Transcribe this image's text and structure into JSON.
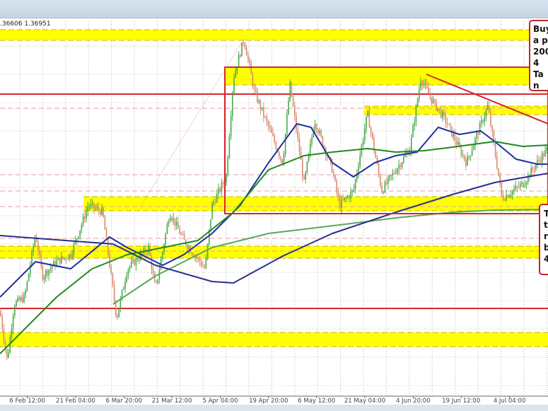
{
  "header": {
    "ohlc_text": ".36606 1.36951"
  },
  "annotations": {
    "box1_lines": [
      "Buy",
      "a p",
      "200",
      "4",
      "Ta",
      "n"
    ],
    "box2_lines": [
      "T",
      "t",
      "r",
      "b",
      "4"
    ]
  },
  "colors": {
    "yellow_band": "#ffff00",
    "red_level": "#d7262c",
    "ma_blue": "#1e2fa0",
    "ma_green": "#1f8a1f",
    "ma_light_green": "#5aa85a",
    "ma_dark_blue": "#2a2f8f",
    "candle_up": "#4aa84a",
    "candle_down": "#d98a6e"
  },
  "chart_data": {
    "type": "line",
    "title": "",
    "xlabel": "",
    "ylabel": "",
    "xlim": [
      0,
      166.7
    ],
    "ylim": [
      1.3365,
      1.39
    ],
    "x_unit": "days from chart start",
    "grid": true,
    "x_ticks": [
      {
        "t": 8.3,
        "label": "6 Feb 12:00"
      },
      {
        "t": 23.0,
        "label": "21 Feb 04:00"
      },
      {
        "t": 37.7,
        "label": "6 Mar 20:00"
      },
      {
        "t": 52.3,
        "label": "21 Mar 12:00"
      },
      {
        "t": 67.0,
        "label": "5 Apr 04:00"
      },
      {
        "t": 81.7,
        "label": "19 Apr 20:00"
      },
      {
        "t": 96.3,
        "label": "6 May 12:00"
      },
      {
        "t": 111.0,
        "label": "21 May 04:00"
      },
      {
        "t": 125.7,
        "label": "4 Jun 20:00"
      },
      {
        "t": 140.3,
        "label": "19 Jun 12:00"
      },
      {
        "t": 155.0,
        "label": "4 Jul 04:00"
      }
    ],
    "price_path": {
      "t": [
        0,
        2.2,
        4.3,
        7.5,
        10.8,
        12.9,
        17.2,
        21.5,
        26.9,
        31.2,
        35.5,
        38.7,
        45.2,
        47.3,
        51.6,
        55.9,
        62.4,
        64.5,
        68.8,
        71.0,
        74.2,
        77.4,
        81.7,
        86.0,
        88.2,
        92.5,
        95.7,
        101.1,
        103.2,
        107.5,
        111.8,
        116.1,
        120.4,
        124.7,
        128.0,
        131.2,
        135.5,
        141.9,
        148.4,
        152.7,
        159.1,
        163.4,
        166.7
      ],
      "price": [
        1.3485,
        1.3415,
        1.3495,
        1.3505,
        1.3595,
        1.3535,
        1.3555,
        1.3565,
        1.3635,
        1.3625,
        1.3475,
        1.3545,
        1.3575,
        1.3515,
        1.3625,
        1.3585,
        1.3545,
        1.3635,
        1.3675,
        1.3815,
        1.387,
        1.3795,
        1.3745,
        1.3695,
        1.3805,
        1.3665,
        1.3755,
        1.3685,
        1.3635,
        1.3655,
        1.3765,
        1.3655,
        1.3685,
        1.3715,
        1.3815,
        1.3785,
        1.3755,
        1.3695,
        1.3775,
        1.3645,
        1.3665,
        1.3695,
        1.3715
      ]
    },
    "series": [
      {
        "name": "MA blue",
        "color": "#1e2fa0",
        "t": [
          0,
          10.8,
          21.5,
          33.3,
          38.7,
          49.5,
          55.9,
          64.5,
          73.1,
          81.7,
          90.3,
          94.6,
          101.1,
          107.5,
          114.0,
          120.4,
          126.9,
          133.3,
          139.8,
          146.2,
          150.5,
          157.0,
          163.4,
          166.7
        ],
        "values": [
          1.3505,
          1.3555,
          1.3545,
          1.359,
          1.3575,
          1.355,
          1.3565,
          1.3595,
          1.3635,
          1.3695,
          1.375,
          1.3745,
          1.3695,
          1.3675,
          1.3695,
          1.3705,
          1.371,
          1.3745,
          1.3735,
          1.374,
          1.3725,
          1.37,
          1.3693,
          1.3693
        ]
      },
      {
        "name": "MA green",
        "color": "#1f8a1f",
        "t": [
          0,
          8.6,
          17.2,
          28.0,
          38.7,
          49.5,
          60.2,
          71.0,
          81.7,
          92.5,
          101.1,
          111.8,
          120.4,
          129.0,
          137.6,
          150.5,
          159.1,
          166.7
        ],
        "values": [
          1.3425,
          1.3465,
          1.3505,
          1.3545,
          1.3565,
          1.3575,
          1.3585,
          1.3625,
          1.3685,
          1.3705,
          1.371,
          1.3715,
          1.371,
          1.3712,
          1.3717,
          1.3725,
          1.3718,
          1.372
        ]
      },
      {
        "name": "MA light green",
        "color": "#5aa85a",
        "t": [
          34.4,
          47.3,
          64.5,
          81.7,
          103.2,
          120.4,
          137.6,
          150.5,
          166.7
        ],
        "values": [
          1.3495,
          1.3535,
          1.3575,
          1.3595,
          1.3607,
          1.3617,
          1.3625,
          1.3628,
          1.3629
        ]
      },
      {
        "name": "MA dark blue",
        "color": "#2a2f8f",
        "t": [
          0,
          34.4,
          47.3,
          64.5,
          71.0,
          86.0,
          101.1,
          120.4,
          137.6,
          150.5,
          166.7
        ],
        "values": [
          1.3592,
          1.358,
          1.355,
          1.3527,
          1.3525,
          1.3563,
          1.3595,
          1.3625,
          1.365,
          1.3667,
          1.368
        ]
      }
    ],
    "yellow_zones": [
      {
        "from_t": 0,
        "low": 1.3868,
        "high": 1.3883
      },
      {
        "from_t": 68.4,
        "low": 1.3805,
        "high": 1.383
      },
      {
        "from_t": 110.8,
        "low": 1.3763,
        "high": 1.3775
      },
      {
        "from_t": 25.4,
        "low": 1.3627,
        "high": 1.3647
      },
      {
        "from_t": 0,
        "low": 1.356,
        "high": 1.3577
      },
      {
        "from_t": 0,
        "low": 1.3435,
        "high": 1.3455
      }
    ],
    "red_levels": [
      1.3792,
      1.3489
    ],
    "dashed_levels": [
      1.3772,
      1.3678,
      1.3655,
      1.3633,
      1.3588,
      1.357
    ],
    "red_box": {
      "t0": 68.4,
      "t1": 166.7,
      "low": 1.3623,
      "high": 1.383
    },
    "red_trendline": {
      "t0": 129.7,
      "p0": 1.382,
      "t1": 166.7,
      "p1": 1.375
    },
    "dotted_trendline": {
      "t0": 43.0,
      "p0": 1.3635,
      "t1": 74.2,
      "p1": 1.387
    }
  }
}
